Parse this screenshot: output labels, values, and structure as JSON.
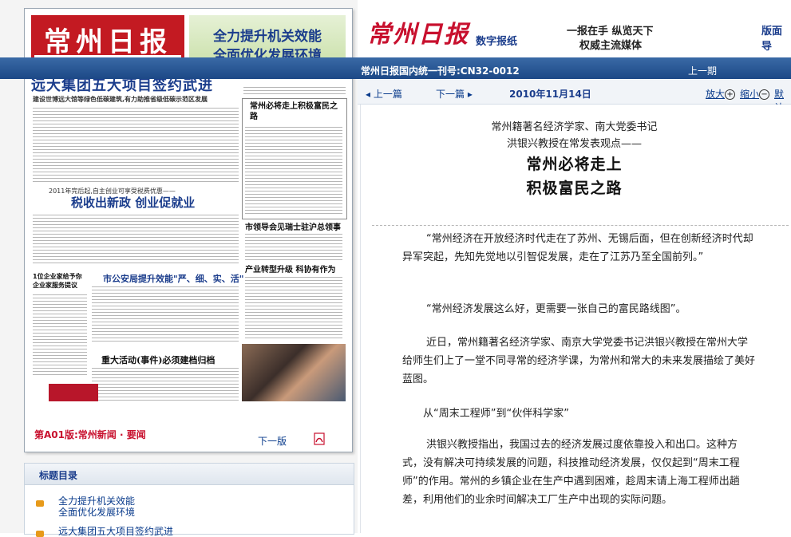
{
  "paper": {
    "masthead_name": "常州日报",
    "slogan_line1": "全力提升机关效能",
    "slogan_line2": "全面优化发展环境",
    "headline": "远大集团五大项目签约武进",
    "subhead": "建设世博远大馆等绿色低碳建筑,有力助推省级低碳示范区发展",
    "section1_intro": "2011年完后起,自主创业可享受税费优惠——",
    "section1_title": "税收出新政 创业促就业",
    "col_title_1": "常州必将走上积极富民之路",
    "col_title_2": "市领导会见瑞士驻沪总领事",
    "col_title_3": "产业转型升级 科协有作为",
    "section2_title": "市公安局提升效能\"严、细、实、活\"",
    "section3_title": "重大活动(事件)必须建档归档",
    "side_title": "1位企业家给予你企业家服务提议",
    "page_label": "第A01版:常州新闻 · 要闻",
    "next_page": "下一版"
  },
  "toc": {
    "title": "标题目录",
    "items": [
      {
        "line1": "全力提升机关效能",
        "line2": "全面优化发展环境"
      },
      {
        "line1": "远大集团五大项目签约武进",
        "line2": ""
      }
    ]
  },
  "header": {
    "brand": "常州日报",
    "digital": "数字报纸",
    "tagline1": "一报在手 纵览天下",
    "tagline2": "权威主流媒体",
    "page_guide": "版面导"
  },
  "bar": {
    "issn": "常州日报国内统一刊号:CN32-0012",
    "prev_issue": "上一期"
  },
  "nav": {
    "prev_article": "◂ 上一篇",
    "next_article": "下一篇 ▸",
    "date": "2010年11月14日",
    "zoom_in": "放大",
    "zoom_out": "缩小",
    "reset": "默认"
  },
  "article": {
    "kicker1": "常州籍著名经济学家、南大党委书记",
    "kicker2": "洪银兴教授在常发表观点——",
    "title1": "常州必将走上",
    "title2": "积极富民之路",
    "p1": "“常州经济在开放经济时代走在了苏州、无锡后面，但在创新经济时代却异军突起，先知先觉地以引智促发展，走在了江苏乃至全国前列。”",
    "p2": "“常州经济发展这么好，更需要一张自己的富民路线图”。",
    "p3": "近日，常州籍著名经济学家、南京大学党委书记洪银兴教授在常州大学给师生们上了一堂不同寻常的经济学课，为常州和常大的未来发展描绘了美好蓝图。",
    "p4": "从“周末工程师”到“伙伴科学家”",
    "p5": "洪银兴教授指出，我国过去的经济发展过度依靠投入和出口。这种方式，没有解决可持续发展的问题，科技推动经济发展，仅仅起到“周末工程师”的作用。常州的乡镇企业在生产中遇到困难，趁周末请上海工程师出趟差，利用他们的业余时间解决工厂生产中出现的实际问题。"
  }
}
